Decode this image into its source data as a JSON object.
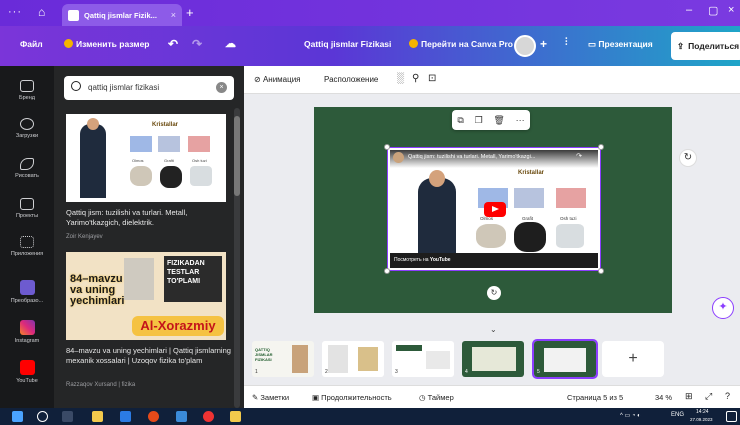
{
  "browser": {
    "tab_title": "Qattiq jismlar Fizik...",
    "tab_close": "×",
    "new_tab": "+",
    "menu": "···",
    "minimize": "–",
    "restore": "▢",
    "close": "×"
  },
  "header": {
    "file": "Файл",
    "resize": "Изменить размер",
    "doc_title": "Qattiq jismlar Fizikasi",
    "upgrade": "Перейти на Canva Pro",
    "add": "+",
    "present": "Презентация",
    "share": "Поделиться"
  },
  "rail": {
    "items": [
      {
        "label": "Бренд"
      },
      {
        "label": "Загрузки"
      },
      {
        "label": "Рисовать"
      },
      {
        "label": "Проекты"
      },
      {
        "label": "Приложения"
      },
      {
        "label": "Преобразо..."
      },
      {
        "label": "Instagram"
      },
      {
        "label": "YouTube"
      }
    ]
  },
  "panel": {
    "search_value": "qattiq jismlar fizikasi",
    "results": [
      {
        "title": "Qattiq jism: tuzilishi va turlari. Metall, Yarimo'tkazgich, dielektrik.",
        "author": "Zoir Kenjayev",
        "thumb_heading": "Kristallar",
        "thumb_labels": [
          "Olmos",
          "Grafit",
          "Osh tuzi"
        ]
      },
      {
        "title": "84–mavzu va uning yechimlari | Qattiq jismlarning mexanik xossalari | Uzoqov fizika to'plam",
        "author": "Razzaqov Xursand | fizika",
        "thumb_banner": "FIZIKADAN TESTLAR TO'PLAMI",
        "thumb_big": "84–mavzu va uning yechimlari",
        "thumb_brand": "Al-Xorazmiy"
      }
    ]
  },
  "toolbar": {
    "animation": "Анимация",
    "position": "Расположение"
  },
  "video": {
    "title": "Qattiq jism: tuzilishi va turlari. Metall, Yarimo'tkazgi...",
    "heading": "Kristallar",
    "labels": [
      "Olmos",
      "Grafit",
      "Osh tuzi"
    ],
    "watch_on": "Посмотреть на",
    "platform": "YouTube"
  },
  "pages": {
    "items": [
      {
        "num": "1",
        "text": "QATTIQ JISMLAR FIZIKASI"
      },
      {
        "num": "2",
        "text": ""
      },
      {
        "num": "3",
        "text": ""
      },
      {
        "num": "4",
        "text": ""
      },
      {
        "num": "5",
        "text": ""
      }
    ],
    "add": "+"
  },
  "bottombar": {
    "notes": "Заметки",
    "duration": "Продолжительность",
    "timer": "Таймер",
    "page_info": "Страница 5 из 5",
    "zoom": "34 %"
  },
  "taskbar": {
    "lang": "ENG",
    "time": "14:24",
    "date": "27.09.2023"
  },
  "colors": {
    "header_start": "#7b35d9",
    "header_end": "#1fa5c8",
    "slide_bg": "#2d5a3a",
    "selection": "#8b3dff"
  }
}
